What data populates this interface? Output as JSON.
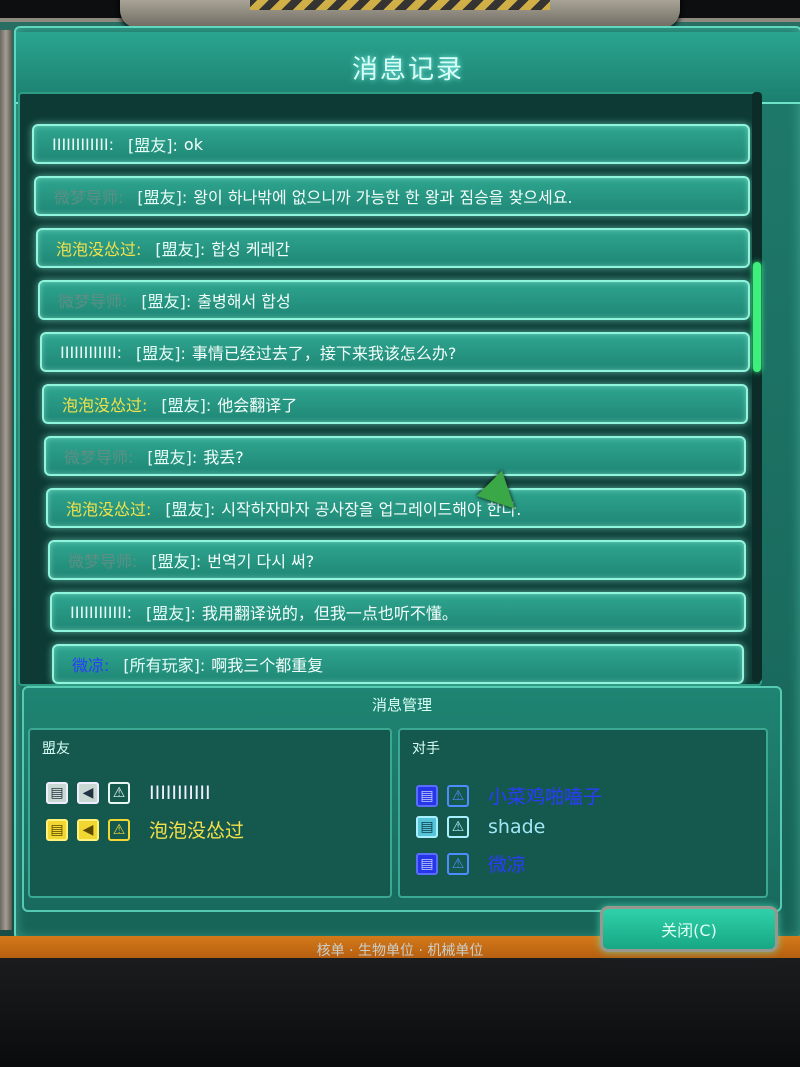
{
  "window": {
    "title": "消息记录"
  },
  "messages": [
    {
      "sender": "IIIIIIIIIIII:",
      "sender_color": "white",
      "channel": "[盟友]:",
      "text": "ok"
    },
    {
      "sender": "微梦导师:",
      "sender_color": "dim",
      "channel": "[盟友]:",
      "text": "왕이 하나밖에 없으니까 가능한 한 왕과 짐승을 찾으세요."
    },
    {
      "sender": "泡泡没怂过:",
      "sender_color": "yellow",
      "channel": "[盟友]:",
      "text": "합성 케레간"
    },
    {
      "sender": "微梦导师:",
      "sender_color": "dim",
      "channel": "[盟友]:",
      "text": "출병해서 합성"
    },
    {
      "sender": "IIIIIIIIIIII:",
      "sender_color": "white",
      "channel": "[盟友]:",
      "text": "事情已经过去了，接下来我该怎么办?"
    },
    {
      "sender": "泡泡没怂过:",
      "sender_color": "yellow",
      "channel": "[盟友]:",
      "text": "他会翻译了"
    },
    {
      "sender": "微梦导师:",
      "sender_color": "dim",
      "channel": "[盟友]:",
      "text": "我丢?"
    },
    {
      "sender": "泡泡没怂过:",
      "sender_color": "yellow",
      "channel": "[盟友]:",
      "text": "시작하자마자 공사장을 업그레이드해야 한다."
    },
    {
      "sender": "微梦导师:",
      "sender_color": "dim",
      "channel": "[盟友]:",
      "text": "번역기 다시 써?"
    },
    {
      "sender": "IIIIIIIIIIII:",
      "sender_color": "white",
      "channel": "[盟友]:",
      "text": "我用翻译说的，但我一点也听不懂。"
    },
    {
      "sender": "微凉:",
      "sender_color": "blue",
      "channel": "[所有玩家]:",
      "text": "啊我三个都重复"
    }
  ],
  "management": {
    "title": "消息管理",
    "allies_label": "盟友",
    "opponents_label": "对手",
    "allies": [
      {
        "name": "IIIIIIIIIII",
        "color": "white",
        "icons": [
          "chat-icon",
          "voice-icon",
          "alert-icon"
        ]
      },
      {
        "name": "泡泡没怂过",
        "color": "yellow",
        "icons": [
          "chat-icon",
          "voice-icon",
          "alert-icon"
        ]
      }
    ],
    "opponents": [
      {
        "name": "小菜鸡啪嗑子",
        "color": "blue",
        "icons": [
          "chat-icon",
          "alert-icon"
        ]
      },
      {
        "name": "shade",
        "color": "cyan",
        "icons": [
          "chat-icon",
          "alert-icon"
        ]
      },
      {
        "name": "微凉",
        "color": "blue",
        "icons": [
          "chat-icon",
          "alert-icon"
        ]
      }
    ]
  },
  "buttons": {
    "close": "关闭(C)"
  },
  "footer": {
    "text": "核单 · 生物单位 · 机械单位"
  }
}
